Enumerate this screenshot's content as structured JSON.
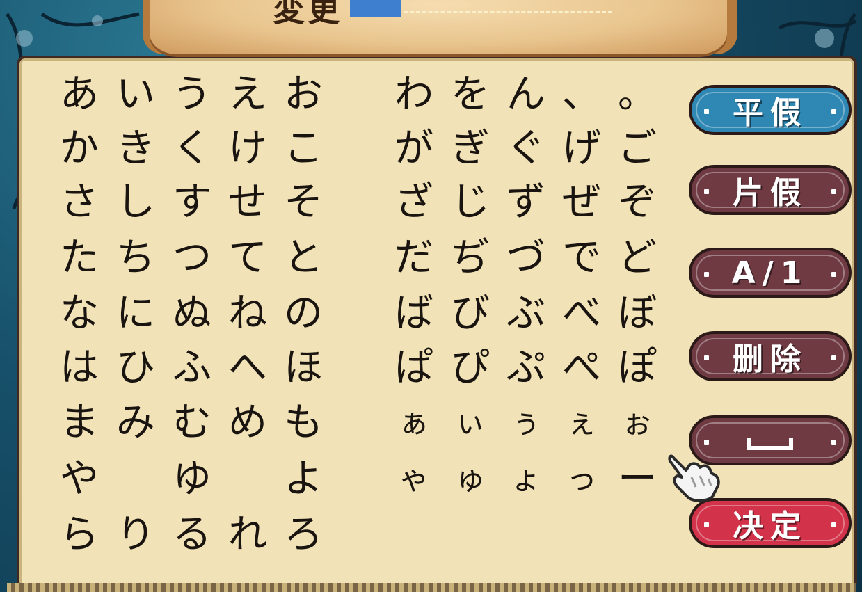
{
  "header": {
    "name_label": "変更"
  },
  "kana": [
    [
      {
        "t": "あ"
      },
      {
        "t": "い"
      },
      {
        "t": "う"
      },
      {
        "t": "え"
      },
      {
        "t": "お"
      },
      {
        "t": "わ"
      },
      {
        "t": "を"
      },
      {
        "t": "ん"
      },
      {
        "t": "、"
      },
      {
        "t": "。"
      }
    ],
    [
      {
        "t": "か"
      },
      {
        "t": "き"
      },
      {
        "t": "く"
      },
      {
        "t": "け"
      },
      {
        "t": "こ"
      },
      {
        "t": "が"
      },
      {
        "t": "ぎ"
      },
      {
        "t": "ぐ"
      },
      {
        "t": "げ"
      },
      {
        "t": "ご"
      }
    ],
    [
      {
        "t": "さ"
      },
      {
        "t": "し"
      },
      {
        "t": "す"
      },
      {
        "t": "せ"
      },
      {
        "t": "そ"
      },
      {
        "t": "ざ"
      },
      {
        "t": "じ"
      },
      {
        "t": "ず"
      },
      {
        "t": "ぜ"
      },
      {
        "t": "ぞ"
      }
    ],
    [
      {
        "t": "た"
      },
      {
        "t": "ち"
      },
      {
        "t": "つ"
      },
      {
        "t": "て"
      },
      {
        "t": "と"
      },
      {
        "t": "だ"
      },
      {
        "t": "ぢ"
      },
      {
        "t": "づ"
      },
      {
        "t": "で"
      },
      {
        "t": "ど"
      }
    ],
    [
      {
        "t": "な"
      },
      {
        "t": "に"
      },
      {
        "t": "ぬ"
      },
      {
        "t": "ね"
      },
      {
        "t": "の"
      },
      {
        "t": "ば"
      },
      {
        "t": "び"
      },
      {
        "t": "ぶ"
      },
      {
        "t": "べ"
      },
      {
        "t": "ぼ"
      }
    ],
    [
      {
        "t": "は"
      },
      {
        "t": "ひ"
      },
      {
        "t": "ふ"
      },
      {
        "t": "へ"
      },
      {
        "t": "ほ"
      },
      {
        "t": "ぱ"
      },
      {
        "t": "ぴ"
      },
      {
        "t": "ぷ"
      },
      {
        "t": "ぺ"
      },
      {
        "t": "ぽ"
      }
    ],
    [
      {
        "t": "ま"
      },
      {
        "t": "み"
      },
      {
        "t": "む"
      },
      {
        "t": "め"
      },
      {
        "t": "も"
      },
      {
        "t": "ぁ",
        "small": true
      },
      {
        "t": "ぃ",
        "small": true
      },
      {
        "t": "ぅ",
        "small": true
      },
      {
        "t": "ぇ",
        "small": true
      },
      {
        "t": "ぉ",
        "small": true
      }
    ],
    [
      {
        "t": "や"
      },
      {
        "t": ""
      },
      {
        "t": "ゆ"
      },
      {
        "t": ""
      },
      {
        "t": "よ"
      },
      {
        "t": "ゃ",
        "small": true
      },
      {
        "t": "ゅ",
        "small": true
      },
      {
        "t": "ょ",
        "small": true
      },
      {
        "t": "っ",
        "small": true
      },
      {
        "t": "ー"
      }
    ],
    [
      {
        "t": "ら"
      },
      {
        "t": "り"
      },
      {
        "t": "る"
      },
      {
        "t": "れ"
      },
      {
        "t": "ろ"
      },
      {
        "t": ""
      },
      {
        "t": ""
      },
      {
        "t": ""
      },
      {
        "t": ""
      },
      {
        "t": ""
      }
    ]
  ],
  "buttons": [
    {
      "name": "hiragana-button",
      "label": "平假",
      "style": "blue",
      "icon": ""
    },
    {
      "name": "katakana-button",
      "label": "片假",
      "style": "maroon",
      "icon": ""
    },
    {
      "name": "alphanumeric-button",
      "label": "A/1",
      "style": "maroon",
      "icon": ""
    },
    {
      "name": "delete-button",
      "label": "删除",
      "style": "maroon",
      "icon": ""
    },
    {
      "name": "space-button",
      "label": "",
      "style": "maroon",
      "icon": "space-icon"
    },
    {
      "name": "confirm-button",
      "label": "决定",
      "style": "red",
      "icon": ""
    }
  ],
  "colors": {
    "panel": "#f1e3b7",
    "frame": "#17506a",
    "button_blue": "#2f87b4",
    "button_maroon": "#6f3a42",
    "button_red": "#d2324a",
    "name_cursor": "#3f7fd0",
    "kana_text": "#1a1410"
  },
  "cursor": {
    "icon": "pointing-hand-icon",
    "target": "space-button"
  }
}
